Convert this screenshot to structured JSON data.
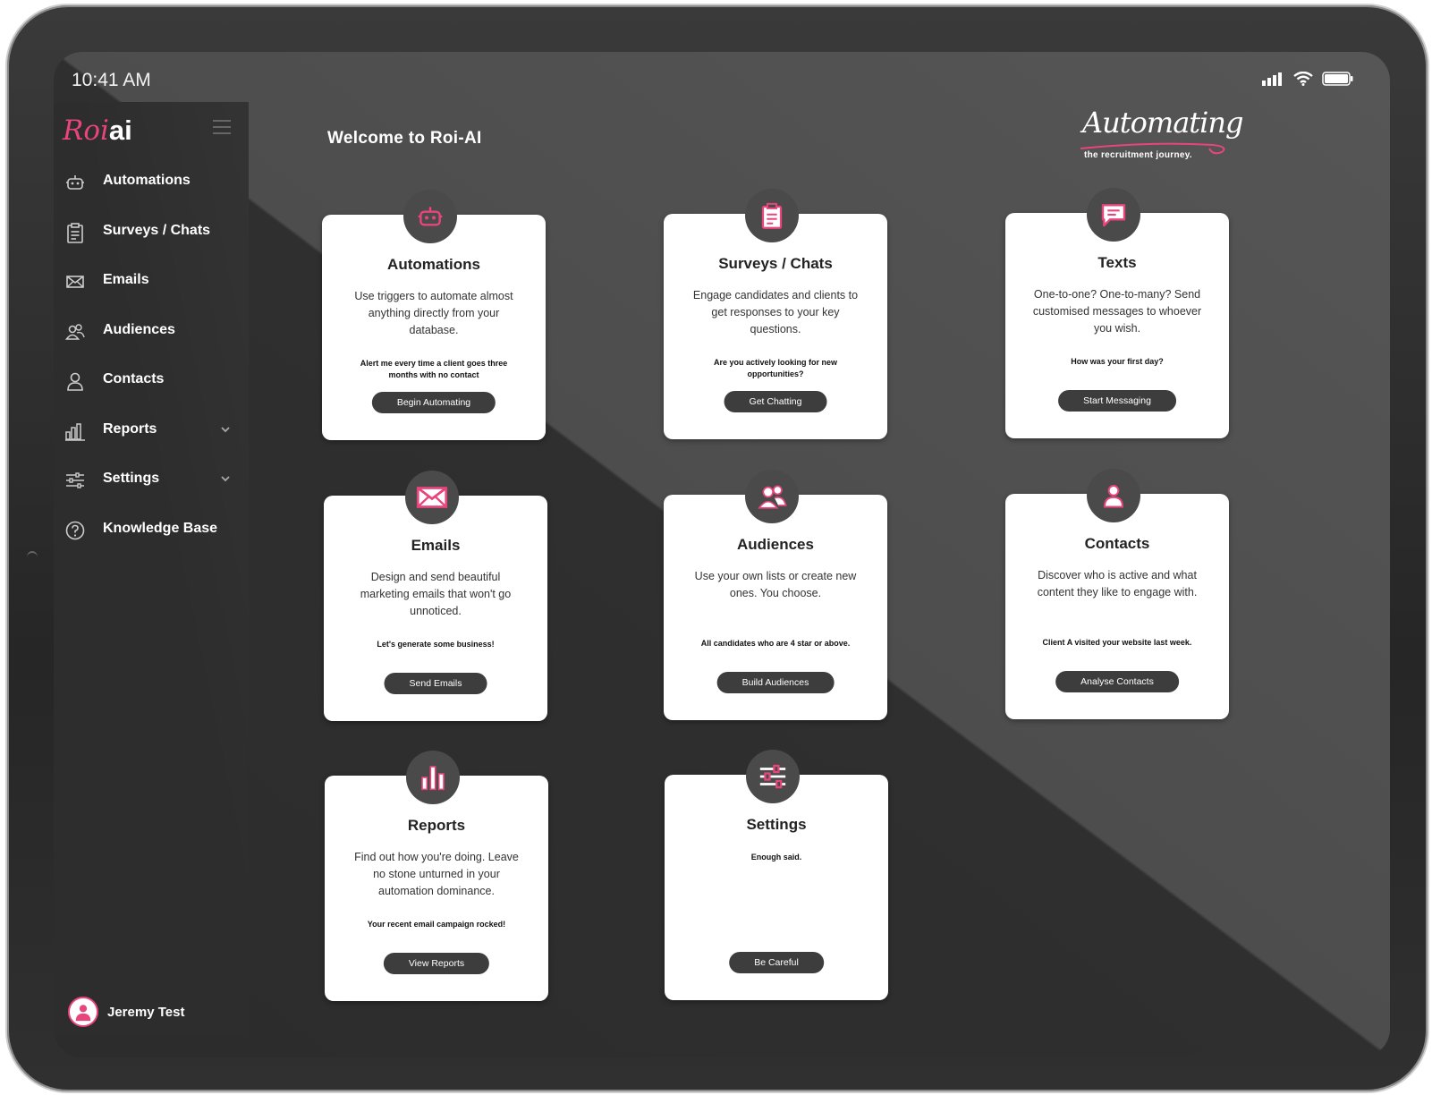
{
  "status": {
    "time": "10:41 AM"
  },
  "sidebar": {
    "logo_roi": "Roi",
    "logo_ai": "ai",
    "items": [
      {
        "label": "Automations",
        "icon": "robot-icon"
      },
      {
        "label": "Surveys / Chats",
        "icon": "clipboard-icon"
      },
      {
        "label": "Emails",
        "icon": "envelope-icon"
      },
      {
        "label": "Audiences",
        "icon": "group-icon"
      },
      {
        "label": "Contacts",
        "icon": "person-icon"
      },
      {
        "label": "Reports",
        "icon": "bar-chart-icon",
        "expandable": true
      },
      {
        "label": "Settings",
        "icon": "sliders-icon",
        "expandable": true
      },
      {
        "label": "Knowledge Base",
        "icon": "help-circle-icon"
      }
    ],
    "user": "Jeremy Test"
  },
  "header": {
    "welcome": "Welcome to Roi-AI",
    "brand_script": "Automating",
    "brand_tagline": "the recruitment journey."
  },
  "cards": [
    {
      "title": "Automations",
      "desc": "Use triggers to automate almost anything directly from your database.",
      "example": "Alert me every time a client goes three months with no contact",
      "button": "Begin Automating",
      "icon": "robot-icon"
    },
    {
      "title": "Surveys / Chats",
      "desc": "Engage candidates and clients to get responses to your key questions.",
      "example": "Are you actively looking for new opportunities?",
      "button": "Get Chatting",
      "icon": "clipboard-icon"
    },
    {
      "title": "Texts",
      "desc": "One-to-one? One-to-many? Send customised messages to whoever you wish.",
      "example": "How was your first day?",
      "button": "Start Messaging",
      "icon": "chat-bubble-icon"
    },
    {
      "title": "Emails",
      "desc": "Design and send beautiful marketing emails that won't go unnoticed.",
      "example": "Let's generate some business!",
      "button": "Send Emails",
      "icon": "envelope-icon"
    },
    {
      "title": "Audiences",
      "desc": "Use your own lists or create new ones. You choose.",
      "example": "All candidates who are 4 star or above.",
      "button": "Build Audiences",
      "icon": "group-icon"
    },
    {
      "title": "Contacts",
      "desc": "Discover who is active and what content they like to engage with.",
      "example": "Client A visited your website last week.",
      "button": "Analyse Contacts",
      "icon": "person-icon"
    },
    {
      "title": "Reports",
      "desc": "Find out how you're doing. Leave no stone unturned in your automation dominance.",
      "example": "Your recent email campaign rocked!",
      "button": "View Reports",
      "icon": "bar-chart-icon"
    },
    {
      "title": "Settings",
      "desc": "",
      "example": "Enough said.",
      "button": "Be Careful",
      "icon": "sliders-icon"
    }
  ],
  "colors": {
    "accent": "#e8457c",
    "card_button": "#3d3d3d",
    "sidebar": "#2d2d2d"
  }
}
